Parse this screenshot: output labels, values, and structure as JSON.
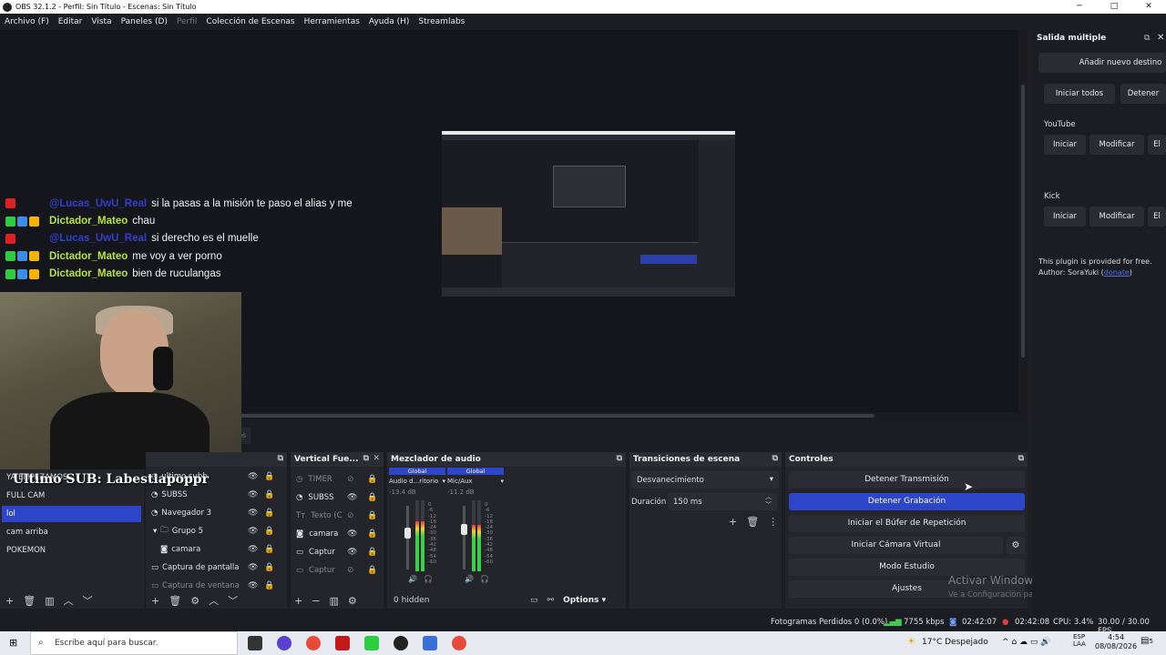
{
  "window": {
    "title": "OBS 32.1.2 - Perfil: Sin Título - Escenas: Sin Título"
  },
  "menu": [
    "Archivo (F)",
    "Editar",
    "Vista",
    "Paneles (D)",
    "Perfil",
    "Colección de Escenas",
    "Herramientas",
    "Ayuda (H)",
    "Streamlabs"
  ],
  "chat": [
    {
      "user": "@Lucas_UwU_Real",
      "message": "si la pasas a la misión te paso el alias y me",
      "user_color": "#2f3fd0"
    },
    {
      "user": "Dictador_Mateo",
      "message": "chau",
      "user_color": "#b7e53a"
    },
    {
      "user": "@Lucas_UwU_Real",
      "message": "si derecho es el muelle",
      "user_color": "#2f3fd0"
    },
    {
      "user": "Dictador_Mateo",
      "message": "me voy a ver porno",
      "user_color": "#b7e53a"
    },
    {
      "user": "Dictador_Mateo",
      "message": "bien de ruculangas",
      "user_color": "#b7e53a"
    }
  ],
  "overlay": {
    "last_sub": "Ultimo SUB: Labestiapoppr"
  },
  "scenes": {
    "tab_partial": "os",
    "items": [
      "YA EMPEZAMOS",
      "FULL CAM",
      "lol",
      "cam arriba",
      "POKEMON"
    ],
    "selected": "lol"
  },
  "sources": {
    "items": [
      "ultimo subb",
      "SUBSS",
      "Navegador 3",
      "Grupo 5",
      "camara",
      "Captura de pantalla",
      "Captura de ventana"
    ]
  },
  "vertical": {
    "title": "Vertical Fue...",
    "items": [
      "TIMER",
      "SUBSS",
      "Texto (C",
      "camara",
      "Captur",
      "Captur"
    ]
  },
  "mixer": {
    "title": "Mezclador de audio",
    "channels": [
      {
        "global": "Global",
        "name": "Audio d...ritorio",
        "db": "-13.4 dB",
        "level": 0.7
      },
      {
        "global": "Global",
        "name": "Mic/Aux",
        "db": "-11.2 dB",
        "level": 0.65
      }
    ],
    "scale": [
      "0",
      "-6",
      "-12",
      "-18",
      "-24",
      "-30",
      "-36",
      "-42",
      "-48",
      "-54",
      "-60"
    ],
    "hidden_label": "0 hidden",
    "options_label": "Options"
  },
  "transitions": {
    "title": "Transiciones de escena",
    "selected": "Desvanecimiento",
    "duration_label": "Duración",
    "duration_value": "150 ms"
  },
  "controls": {
    "title": "Controles",
    "buttons": [
      "Detener Transmisión",
      "Detener Grabación",
      "Iniciar el Búfer de Repetición",
      "Iniciar Cámara Virtual",
      "Modo Estudio",
      "Ajustes"
    ]
  },
  "multi_output": {
    "title": "Salida múltiple",
    "add_button": "Añadir nuevo destino",
    "start_all": "Iniciar todos",
    "stop_all": "Detener",
    "targets": [
      {
        "name": "YouTube",
        "start": "Iniciar",
        "modify": "Modificar",
        "delete": "El"
      },
      {
        "name": "Kick",
        "start": "Iniciar",
        "modify": "Modificar",
        "delete": "El"
      }
    ],
    "note": "This plugin is provided for free.",
    "author_prefix": "Author: SoraYuki (",
    "donate": "donate",
    "author_suffix": ")"
  },
  "watermark": {
    "title": "Activar Windows",
    "subtitle": "Ve a Configuración para activar Windows."
  },
  "status": {
    "dropped": "Fotogramas Perdidos 0 (0.0%)",
    "bitrate": "7755 kbps",
    "stream_time": "02:42:07",
    "rec_time": "02:42:08",
    "cpu": "CPU: 3.4%",
    "fps": "30.00 / 30.00 FPS"
  },
  "taskbar": {
    "search_placeholder": "Escribe aquí para buscar.",
    "weather": "17°C  Despejado",
    "lang1": "ESP",
    "lang2": "LAA",
    "time": "4:54",
    "date": "08/08/2026",
    "notif": "5"
  }
}
